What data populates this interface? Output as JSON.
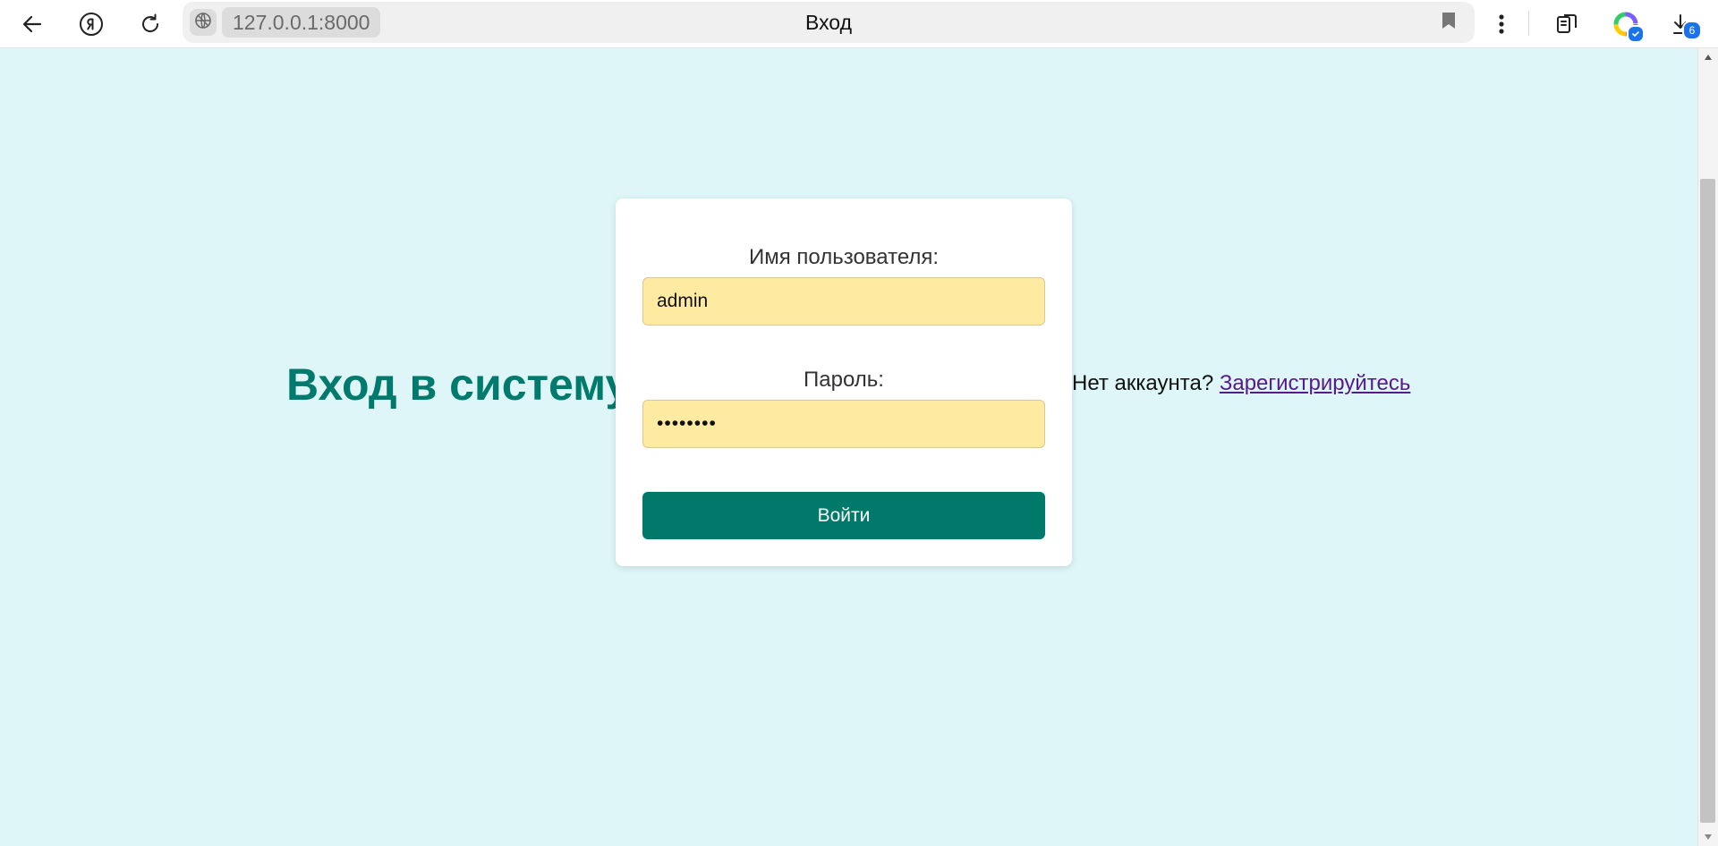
{
  "browser": {
    "url": "127.0.0.1:8000",
    "tab_title": "Вход",
    "downloads_count": "6",
    "icons": {
      "back": "arrow-left-icon",
      "home": "yandex-icon",
      "reload": "reload-icon",
      "site_info": "globe-icon",
      "bookmark": "bookmark-icon",
      "menu": "kebab-menu-icon",
      "tabs": "collections-icon",
      "assistant": "alice-icon",
      "downloads": "download-icon"
    }
  },
  "page": {
    "heading": "Вход в систему",
    "form": {
      "username_label": "Имя пользователя:",
      "username_value": "admin",
      "password_label": "Пароль:",
      "password_value": "••••••••",
      "submit_label": "Войти"
    },
    "register": {
      "prompt": "Нет аккаунта?",
      "link_text": "Зарегистрируйтесь"
    }
  },
  "colors": {
    "page_background": "#def6f7",
    "heading": "#007a6c",
    "input_background": "#ffeaa1",
    "button": "#00796b",
    "link": "#551a8b"
  }
}
